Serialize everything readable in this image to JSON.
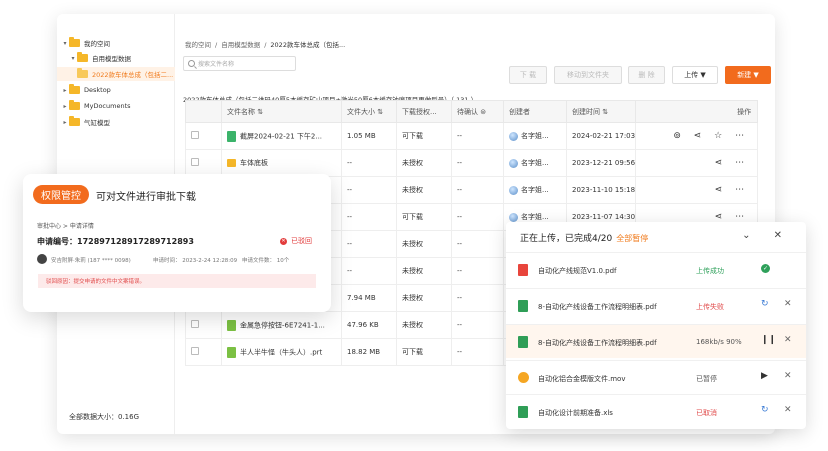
{
  "sidebar": {
    "items": [
      {
        "label": "我的空间"
      },
      {
        "label": "自用模型数据"
      },
      {
        "label": "2022款车体总成（包括二..."
      },
      {
        "label": "Desktop"
      },
      {
        "label": "MyDocuments"
      },
      {
        "label": "气缸模型"
      }
    ],
    "storage": "全部数据大小：0.16G"
  },
  "breadcrumb": [
    "我的空间",
    "/",
    "自用模型数据",
    "/",
    "2022款车体总成（包括..."
  ],
  "search": {
    "placeholder": "搜索文件名称"
  },
  "toolbar": {
    "download": "下 载",
    "move": "移动到文件夹",
    "delete": "删 除",
    "upload": "上传 ▼",
    "new": "新建 ▼"
  },
  "subtitle": "2022款车体总成（包括二维码40厚5本缓存矿山项目+激光50厚6本缓存钟廉项目再做型号）（ 131 ）",
  "table": {
    "headers": [
      "",
      "文件名称 ⇅",
      "文件大小 ⇅",
      "下载授权...",
      "待确认 ⊜",
      "创建者",
      "创建时间 ⇅",
      "操作"
    ],
    "rows": [
      {
        "name": "截屏2024-02-21 下午2...",
        "size": "1.05 MB",
        "auth": "可下载",
        "pending": "--",
        "creator": "名字姐...",
        "time": "2024-02-21 17:03",
        "ops": "⊚ ⋖ ☆ ⋯"
      },
      {
        "name": "车体底板",
        "size": "--",
        "auth": "未授权",
        "pending": "--",
        "creator": "名字姐...",
        "time": "2023-12-21 09:56",
        "ops": "⋖ ⋯"
      },
      {
        "name": "",
        "size": "--",
        "auth": "未授权",
        "pending": "--",
        "creator": "名字姐...",
        "time": "2023-11-10 15:18",
        "ops": "⋖ ⋯"
      },
      {
        "name": "",
        "size": "--",
        "auth": "可下载",
        "pending": "--",
        "creator": "名字姐...",
        "time": "2023-11-07 14:30",
        "ops": "⋖ ⋯"
      },
      {
        "name": "",
        "size": "--",
        "auth": "未授权",
        "pending": "--",
        "creator": "",
        "time": "",
        "ops": ""
      },
      {
        "name": "",
        "size": "--",
        "auth": "未授权",
        "pending": "--",
        "creator": "",
        "time": "",
        "ops": ""
      },
      {
        "name": "",
        "size": "7.94 MB",
        "auth": "未授权",
        "pending": "--",
        "creator": "",
        "time": "",
        "ops": ""
      },
      {
        "name": "金属急停按钮-6E7241-1...",
        "size": "47.96 KB",
        "auth": "未授权",
        "pending": "--",
        "creator": "",
        "time": "",
        "ops": ""
      },
      {
        "name": "半人半牛怪（牛头人）.prt",
        "size": "18.82 MB",
        "auth": "可下载",
        "pending": "--",
        "creator": "",
        "time": "",
        "ops": ""
      }
    ]
  },
  "approval": {
    "badge": "权限管控",
    "title": "可对文件进行审批下载",
    "crumbs": "审批中心  >  申请详情",
    "number": "申请编号：172897128917289712893",
    "status": "已驳回",
    "applicant": "安吉附屏·朱莉 (187 **** 0098)",
    "time": "申请时间： 2023-2-24 12:28:09",
    "count": "申请文件数：  10个",
    "reason": "驳回原因：提交申请的文件中文案错误。"
  },
  "upload_panel": {
    "title": "正在上传，已完成4/20",
    "pause_all": "全部暂停",
    "icons": "⌄ ✕",
    "files": [
      {
        "name": "自动化产线规范V1.0.pdf",
        "status": "上传成功",
        "type": "pdf"
      },
      {
        "name": "8-自动化产线设备工作流程明细表.pdf",
        "status": "上传失败",
        "type": "xls"
      },
      {
        "name": "8-自动化产线设备工作流程明细表.pdf",
        "status": "168kb/s 90%",
        "type": "xls"
      },
      {
        "name": "自动化铝合金模版文件.mov",
        "status": "已暂停",
        "type": "mov"
      },
      {
        "name": "自动化设计前期准备.xls",
        "status": "已取消",
        "type": "xls"
      }
    ]
  }
}
